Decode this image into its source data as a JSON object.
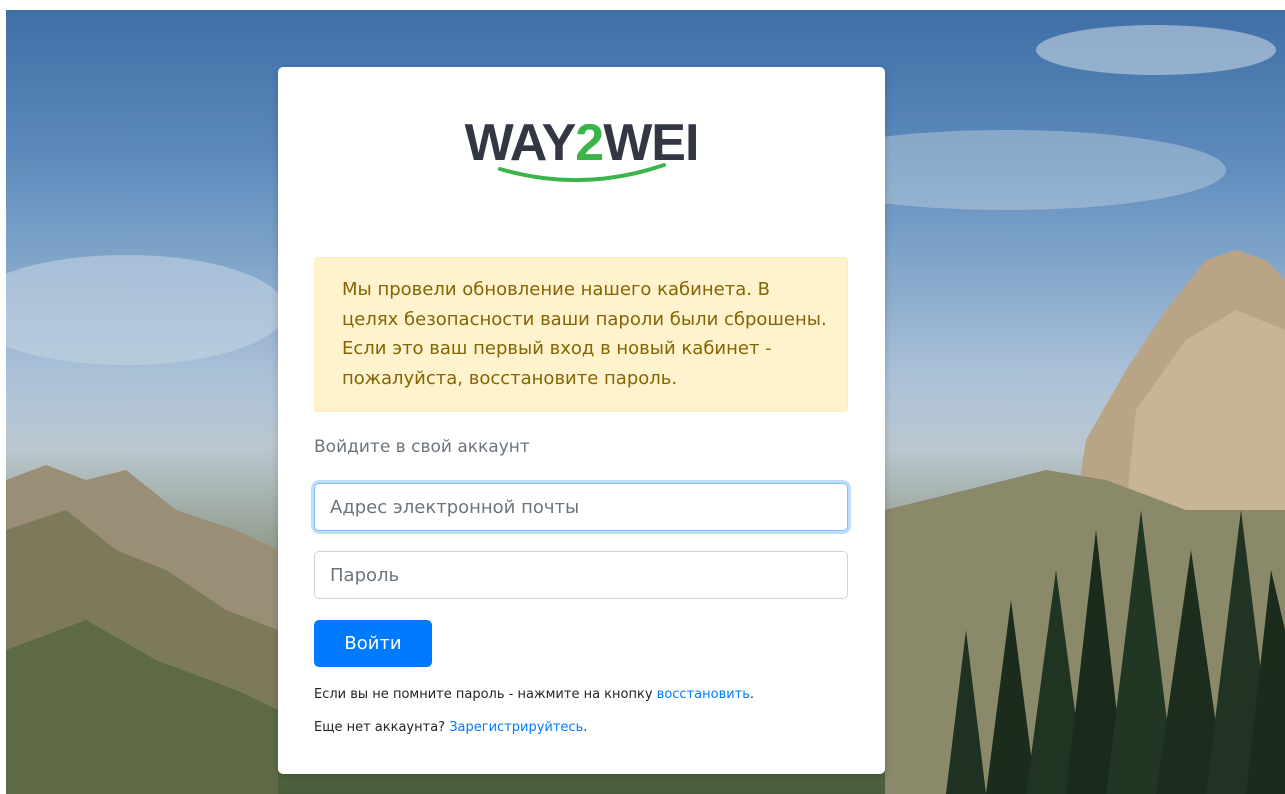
{
  "logo": {
    "text_left": "WAY",
    "text_mid": "2",
    "text_right": "WEI",
    "brand_dark": "#333744",
    "brand_green": "#39b54a"
  },
  "alert": {
    "message": "Мы провели обновление нашего кабинета. В целях безопасности ваши пароли были сброшены. Если это ваш первый вход в новый кабинет - пожалуйста, восстановите пароль."
  },
  "login": {
    "heading": "Войдите в свой аккаунт",
    "email_placeholder": "Адрес электронной почты",
    "password_placeholder": "Пароль",
    "submit_label": "Войти"
  },
  "help": {
    "forgot_text": "Если вы не помните пароль - нажмите на кнопку ",
    "forgot_link": "восстановить",
    "forgot_end": ".",
    "register_text": "Еще нет аккаунта? ",
    "register_link": "Зарегистрируйтесь",
    "register_end": "."
  },
  "colors": {
    "primary": "#007bff",
    "alert_bg": "#fff3cd",
    "alert_text": "#856404"
  }
}
